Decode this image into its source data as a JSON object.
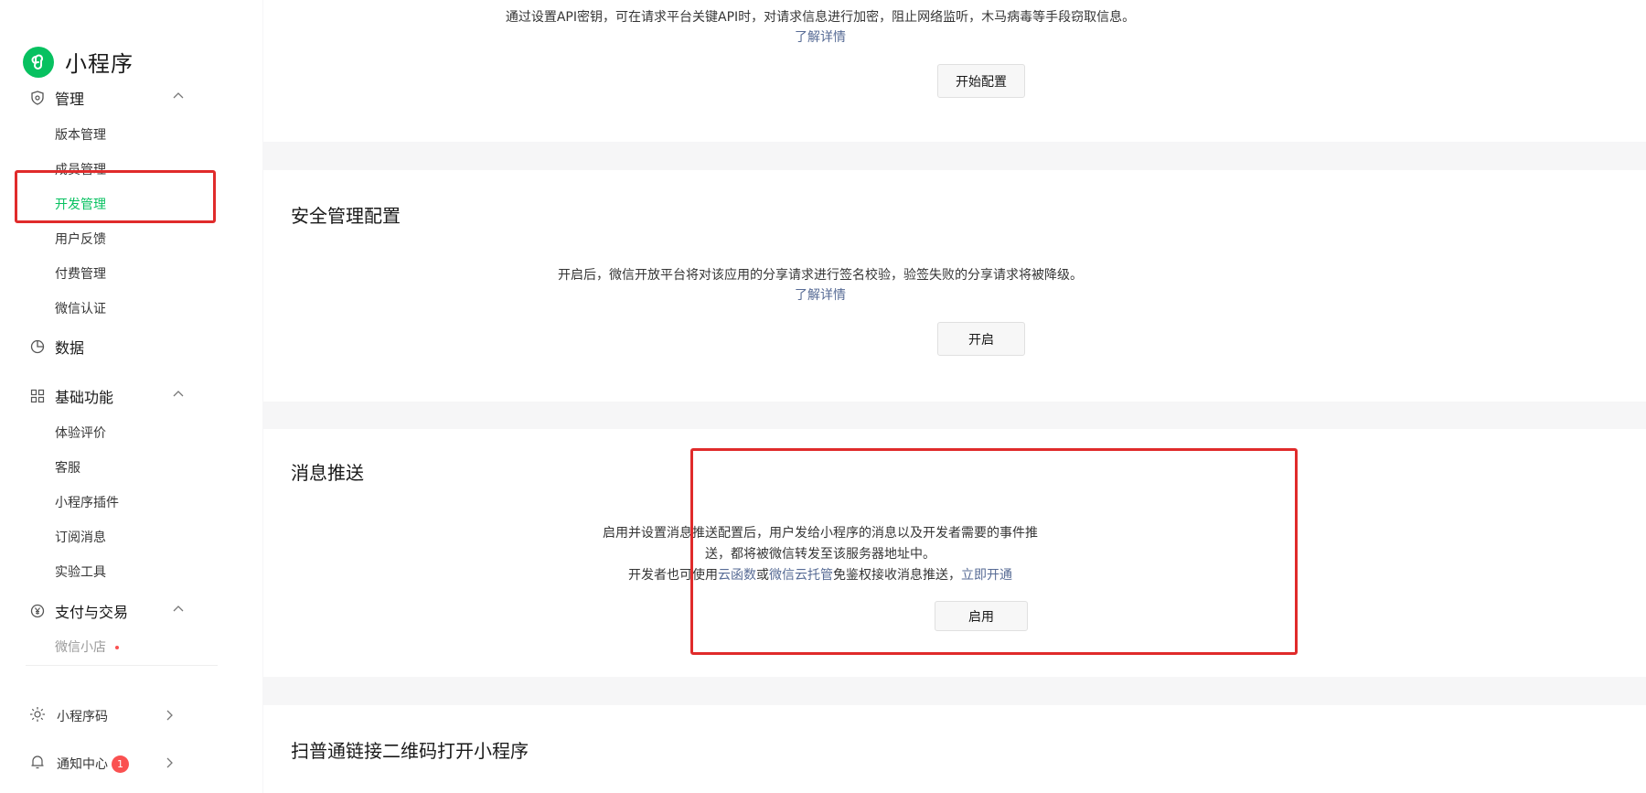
{
  "brand": {
    "name": "小程序"
  },
  "sidebar": {
    "groups": [
      {
        "label": "管理",
        "icon": "shield-icon",
        "expanded": true
      },
      {
        "label": "数据",
        "icon": "pie-chart-icon"
      },
      {
        "label": "基础功能",
        "icon": "grid-icon",
        "expanded": true
      },
      {
        "label": "支付与交易",
        "icon": "yen-icon",
        "expanded": true
      }
    ],
    "manage_items": [
      "版本管理",
      "成员管理",
      "开发管理",
      "用户反馈",
      "付费管理",
      "微信认证"
    ],
    "basic_items": [
      "体验评价",
      "客服",
      "小程序插件",
      "订阅消息",
      "实验工具"
    ],
    "pay_items": [
      "微信小店"
    ],
    "active_item": "开发管理",
    "footer": [
      {
        "label": "小程序码",
        "icon": "sun-icon"
      },
      {
        "label": "通知中心",
        "icon": "bell-icon",
        "badge": "1"
      }
    ]
  },
  "panels": {
    "api_key": {
      "desc": "通过设置API密钥，可在请求平台关键API时，对请求信息进行加密，阻止网络监听，木马病毒等手段窃取信息。",
      "link": "了解详情",
      "button": "开始配置"
    },
    "security": {
      "title": "安全管理配置",
      "desc": "开启后，微信开放平台将对该应用的分享请求进行签名校验，验签失败的分享请求将被降级。",
      "link": "了解详情",
      "button": "开启"
    },
    "push": {
      "title": "消息推送",
      "desc_line1": "启用并设置消息推送配置后，用户发给小程序的消息以及开发者需要的事件推",
      "desc_line2": "送，都将被微信转发至该服务器地址中。",
      "desc_line3_pre": "开发者也可使用",
      "link_cloud_fn": "云函数",
      "or": "或",
      "link_cloud_host": "微信云托管",
      "desc_line3_post": "免鉴权接收消息推送，",
      "link_open": "立即开通",
      "button": "启用"
    },
    "qrcode": {
      "title": "扫普通链接二维码打开小程序"
    }
  },
  "colors": {
    "accent": "#07c160",
    "link": "#576b95",
    "highlight": "#e02b2b",
    "badge": "#fa5151"
  }
}
